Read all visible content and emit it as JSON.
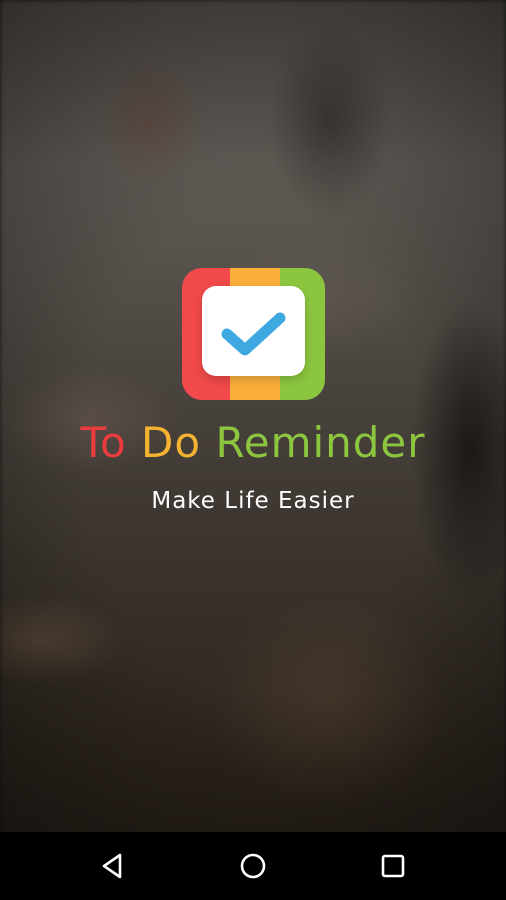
{
  "app": {
    "name_parts": [
      "To",
      "Do",
      "Reminder"
    ],
    "tagline": "Make Life Easier"
  },
  "logo": {
    "icon": "checkmark-icon",
    "colors": {
      "red": "#f24a4a",
      "orange": "#fbb03b",
      "green": "#8cc63f",
      "check": "#3ea8e0"
    }
  },
  "title_colors": {
    "to": "#ea3c3c",
    "do": "#f5b331",
    "reminder": "#8cc63f"
  },
  "navbar": {
    "buttons": [
      {
        "name": "back",
        "icon": "triangle-back-icon"
      },
      {
        "name": "home",
        "icon": "circle-home-icon"
      },
      {
        "name": "recents",
        "icon": "square-recents-icon"
      }
    ]
  }
}
